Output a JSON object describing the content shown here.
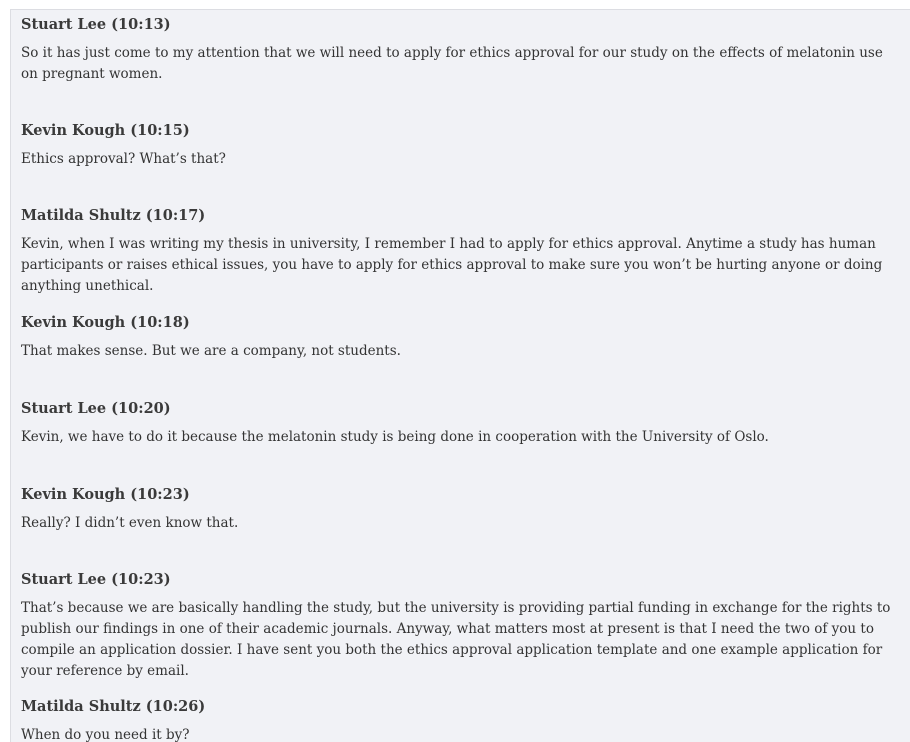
{
  "messages": [
    {
      "sender": "Stuart Lee (10:13)",
      "text": "So it has just come to my attention that we will need to apply for ethics approval for our study on the effects of melatonin use on pregnant women."
    },
    {
      "sender": "Kevin Kough (10:15)",
      "text": "Ethics approval? What’s that?"
    },
    {
      "sender": "Matilda Shultz (10:17)",
      "text": "Kevin, when I was writing my thesis in university, I remember I had to apply for ethics approval. Anytime a study has human participants or raises ethical issues, you have to apply for ethics approval to make sure you won’t be hurting anyone or doing anything unethical."
    },
    {
      "sender": "Kevin Kough (10:18)",
      "text": "That makes sense. But we are a company, not students."
    },
    {
      "sender": "Stuart Lee (10:20)",
      "text": "Kevin, we have to do it because the melatonin study is being done in cooperation with the University of Oslo."
    },
    {
      "sender": "Kevin Kough (10:23)",
      "text": "Really? I didn’t even know that."
    },
    {
      "sender": "Stuart Lee (10:23)",
      "text": "That’s because we are basically handling the study, but the university is providing partial funding in exchange for the rights to publish our findings in one of their academic journals. Anyway, what matters most at present is that I need the two of you to compile an application dossier. I have sent you both the ethics approval application template and one example application for your reference by email."
    },
    {
      "sender": "Matilda Shultz (10:26)",
      "text": "When do you need it by?"
    }
  ]
}
